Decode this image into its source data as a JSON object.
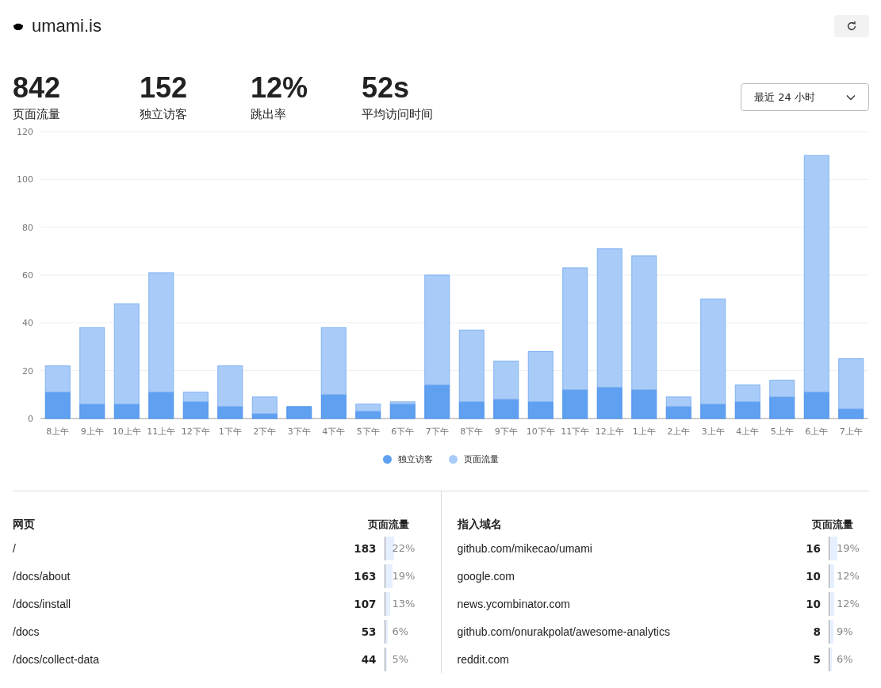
{
  "header": {
    "title": "umami.is"
  },
  "stats": [
    {
      "value": "842",
      "label": "页面流量"
    },
    {
      "value": "152",
      "label": "独立访客"
    },
    {
      "value": "12%",
      "label": "跳出率"
    },
    {
      "value": "52s",
      "label": "平均访问时间"
    }
  ],
  "date_range": {
    "value": "最近 24 小时"
  },
  "chart": {
    "chart_data": {
      "type": "bar",
      "stacked": true,
      "grid": true,
      "ylim": [
        0,
        120
      ],
      "yticks": [
        0,
        20,
        40,
        60,
        80,
        100,
        120
      ],
      "categories": [
        "8上午",
        "9上午",
        "10上午",
        "11上午",
        "12下午",
        "1下午",
        "2下午",
        "3下午",
        "4下午",
        "5下午",
        "6下午",
        "7下午",
        "8下午",
        "9下午",
        "10下午",
        "11下午",
        "12上午",
        "1上午",
        "2上午",
        "3上午",
        "4上午",
        "5上午",
        "6上午",
        "7上午"
      ],
      "series": [
        {
          "name": "独立访客",
          "color": "#5fa0f0",
          "values": [
            11,
            6,
            6,
            11,
            7,
            5,
            2,
            5,
            10,
            3,
            6,
            14,
            7,
            8,
            7,
            12,
            13,
            12,
            5,
            6,
            7,
            9,
            11,
            4
          ]
        },
        {
          "name": "页面流量",
          "color": "#a9cbf7",
          "values": [
            11,
            32,
            42,
            50,
            4,
            17,
            7,
            0,
            28,
            3,
            1,
            46,
            30,
            16,
            21,
            51,
            58,
            56,
            4,
            44,
            7,
            7,
            99,
            21
          ]
        }
      ]
    }
  },
  "tables": [
    {
      "title": "网页",
      "metric": "页面流量",
      "rows": [
        {
          "label": "/",
          "value": "183",
          "percent": "22%",
          "level": 0.22
        },
        {
          "label": "/docs/about",
          "value": "163",
          "percent": "19%",
          "level": 0.19
        },
        {
          "label": "/docs/install",
          "value": "107",
          "percent": "13%",
          "level": 0.13
        },
        {
          "label": "/docs",
          "value": "53",
          "percent": "6%",
          "level": 0.06
        },
        {
          "label": "/docs/collect-data",
          "value": "44",
          "percent": "5%",
          "level": 0.05
        }
      ]
    },
    {
      "title": "指入域名",
      "metric": "页面流量",
      "rows": [
        {
          "label": "github.com/mikecao/umami",
          "value": "16",
          "percent": "19%",
          "level": 0.19
        },
        {
          "label": "google.com",
          "value": "10",
          "percent": "12%",
          "level": 0.12
        },
        {
          "label": "news.ycombinator.com",
          "value": "10",
          "percent": "12%",
          "level": 0.12
        },
        {
          "label": "github.com/onurakpolat/awesome-analytics",
          "value": "8",
          "percent": "9%",
          "level": 0.09
        },
        {
          "label": "reddit.com",
          "value": "5",
          "percent": "6%",
          "level": 0.06
        }
      ]
    }
  ]
}
